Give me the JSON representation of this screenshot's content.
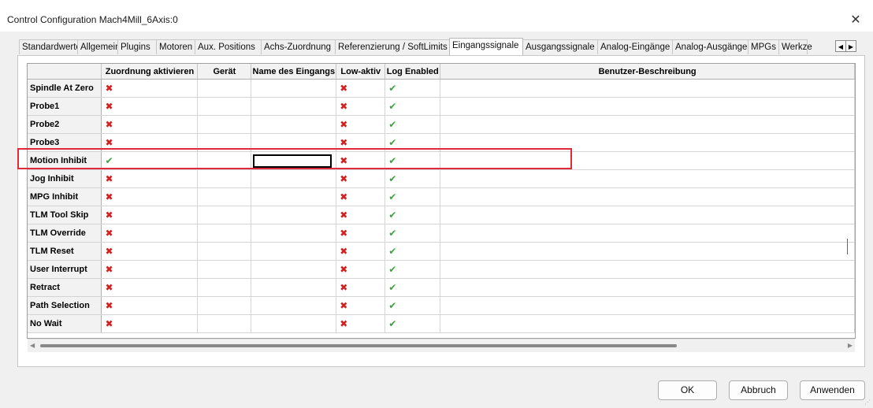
{
  "window": {
    "title": "Control Configuration Mach4Mill_6Axis:0",
    "close_glyph": "✕"
  },
  "tabs": [
    {
      "label": "Standardwerte",
      "active": false
    },
    {
      "label": "Allgemein",
      "active": false
    },
    {
      "label": "Plugins",
      "active": false
    },
    {
      "label": "Motoren",
      "active": false
    },
    {
      "label": "Aux. Positions",
      "active": false
    },
    {
      "label": "Achs-Zuordnung",
      "active": false
    },
    {
      "label": "Referenzierung / SoftLimits",
      "active": false
    },
    {
      "label": "Eingangssignale",
      "active": true
    },
    {
      "label": "Ausgangssignale",
      "active": false
    },
    {
      "label": "Analog-Eingänge",
      "active": false
    },
    {
      "label": "Analog-Ausgänge",
      "active": false
    },
    {
      "label": "MPGs",
      "active": false
    },
    {
      "label": "Werkze",
      "active": false
    }
  ],
  "tab_scroll": {
    "left": "◀",
    "right": "▶"
  },
  "table": {
    "columns": [
      "Zuordnung aktivieren",
      "Gerät",
      "Name des Eingangs",
      "Low-aktiv",
      "Log Enabled",
      "Benutzer-Beschreibung"
    ],
    "rows": [
      {
        "name": "Spindle At Zero",
        "enabled": false,
        "device": "",
        "input": "",
        "low_active": false,
        "log": true,
        "description": ""
      },
      {
        "name": "Probe1",
        "enabled": false,
        "device": "",
        "input": "",
        "low_active": false,
        "log": true,
        "description": ""
      },
      {
        "name": "Probe2",
        "enabled": false,
        "device": "",
        "input": "",
        "low_active": false,
        "log": true,
        "description": ""
      },
      {
        "name": "Probe3",
        "enabled": false,
        "device": "",
        "input": "",
        "low_active": false,
        "log": true,
        "description": ""
      },
      {
        "name": "Motion Inhibit",
        "enabled": true,
        "device": "",
        "input": "",
        "low_active": false,
        "log": true,
        "description": "",
        "selected": true
      },
      {
        "name": "Jog Inhibit",
        "enabled": false,
        "device": "",
        "input": "",
        "low_active": false,
        "log": true,
        "description": ""
      },
      {
        "name": "MPG Inhibit",
        "enabled": false,
        "device": "",
        "input": "",
        "low_active": false,
        "log": true,
        "description": ""
      },
      {
        "name": "TLM Tool Skip",
        "enabled": false,
        "device": "",
        "input": "",
        "low_active": false,
        "log": true,
        "description": ""
      },
      {
        "name": "TLM Override",
        "enabled": false,
        "device": "",
        "input": "",
        "low_active": false,
        "log": true,
        "description": ""
      },
      {
        "name": "TLM Reset",
        "enabled": false,
        "device": "",
        "input": "",
        "low_active": false,
        "log": true,
        "description": ""
      },
      {
        "name": "User Interrupt",
        "enabled": false,
        "device": "",
        "input": "",
        "low_active": false,
        "log": true,
        "description": ""
      },
      {
        "name": "Retract",
        "enabled": false,
        "device": "",
        "input": "",
        "low_active": false,
        "log": true,
        "description": ""
      },
      {
        "name": "Path Selection",
        "enabled": false,
        "device": "",
        "input": "",
        "low_active": false,
        "log": true,
        "description": ""
      },
      {
        "name": "No Wait",
        "enabled": false,
        "device": "",
        "input": "",
        "low_active": false,
        "log": true,
        "description": ""
      }
    ],
    "icons": {
      "check": {
        "name": "green-check-icon",
        "glyph": "✔",
        "color": "#3aa53a"
      },
      "cross": {
        "name": "red-x-icon",
        "glyph": "✖",
        "color": "#d51f1f"
      }
    }
  },
  "hscroll": {
    "left": "◀",
    "right": "▶"
  },
  "highlight_color": "#e0293b",
  "buttons": {
    "ok": "OK",
    "cancel": "Abbruch",
    "apply": "Anwenden"
  }
}
